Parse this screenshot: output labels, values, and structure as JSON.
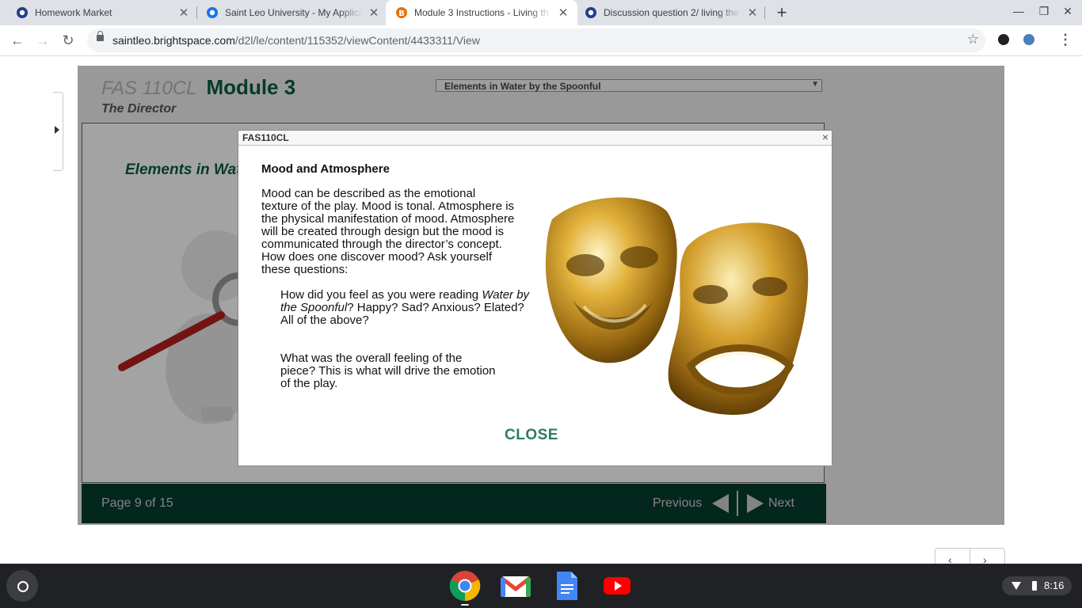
{
  "browser": {
    "tabs": [
      {
        "title": "Homework Market",
        "active": false
      },
      {
        "title": "Saint Leo University - My Applica",
        "active": false
      },
      {
        "title": "Module 3 Instructions - Living th",
        "active": true
      },
      {
        "title": "Discussion question 2/ living the",
        "active": false
      }
    ],
    "new_tab_label": "+",
    "url_host": "saintleo.brightspace.com",
    "url_path": "/d2l/le/content/115352/viewContent/4433311/View"
  },
  "module": {
    "course_code": "FAS 110CL",
    "title": "Module 3",
    "subtitle": "The Director",
    "dropdown_value": "Elements in Water by the Spoonful",
    "section_heading": "Elements in Water by the Spoonful",
    "page_indicator": "Page 9 of 15",
    "previous_label": "Previous",
    "next_label": "Next"
  },
  "dialog": {
    "window_title": "FAS110CL",
    "close_x": "×",
    "heading": "Mood and Atmosphere",
    "paragraph": "Mood can be described as the emotional texture of the play. Mood is tonal. Atmosphere is the physical manifestation of mood. Atmosphere will be created through design but the mood is communicated through the director’s concept. How does one discover mood? Ask yourself these questions:",
    "q1_start": "How did you feel as you were reading ",
    "q1_italic": "Water by the Spoonful",
    "q1_end": "? Happy? Sad? Anxious? Elated?",
    "q1_line2": "All of the above?",
    "q2": "What was the overall feeling of the piece? This is what will drive the emotion of the play.",
    "close_button": "CLOSE"
  },
  "pager": {
    "prev": "‹",
    "next": "›"
  },
  "shelf": {
    "apps": [
      "chrome-icon",
      "gmail-icon",
      "docs-icon",
      "youtube-icon"
    ],
    "time": "8:16"
  },
  "colors": {
    "brand_green": "#0a5c45",
    "footer_green": "#063c2e",
    "close_green": "#2e7d62"
  }
}
